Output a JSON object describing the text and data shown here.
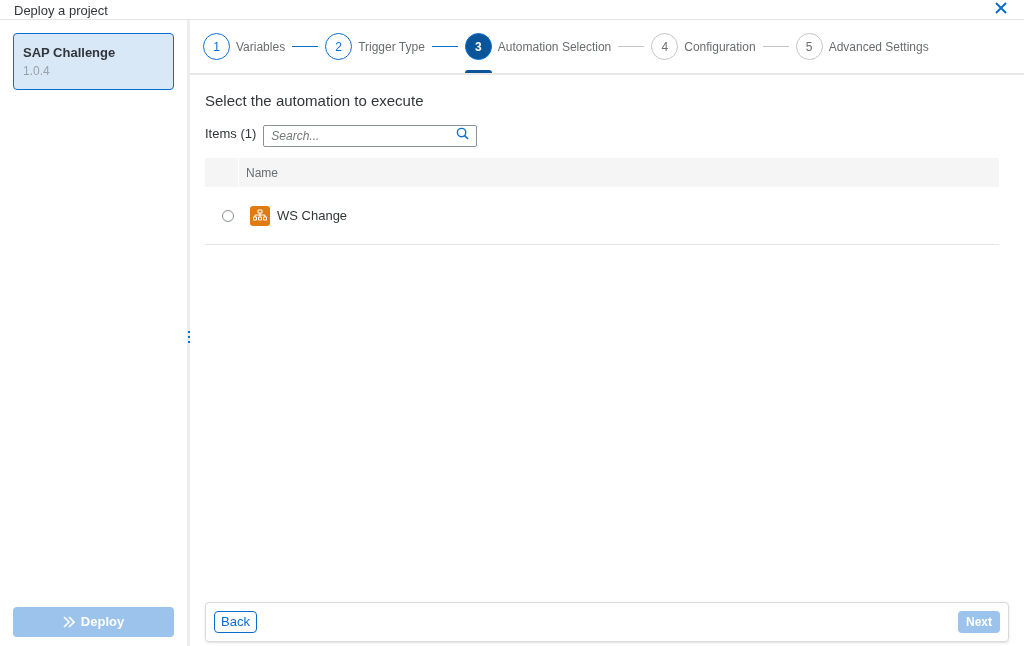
{
  "window": {
    "title": "Deploy a project"
  },
  "sidebar": {
    "project": {
      "name": "SAP Challenge",
      "version": "1.0.4",
      "selected": true
    },
    "deploy_button": {
      "label": "Deploy",
      "disabled": true
    }
  },
  "steps": [
    {
      "number": "1",
      "label": "Variables",
      "completed": true,
      "selected": false
    },
    {
      "number": "2",
      "label": "Trigger Type",
      "completed": true,
      "selected": false
    },
    {
      "number": "3",
      "label": "Automation Selection",
      "completed": false,
      "selected": true
    },
    {
      "number": "4",
      "label": "Configuration",
      "completed": false,
      "selected": false
    },
    {
      "number": "5",
      "label": "Advanced Settings",
      "completed": false,
      "selected": false
    }
  ],
  "content": {
    "heading": "Select the automation to execute",
    "items_count": "Items (1)",
    "search": {
      "placeholder": "Search..."
    },
    "table": {
      "columns": [
        "Name"
      ],
      "rows": [
        {
          "name": "WS Change",
          "selected": false
        }
      ]
    }
  },
  "footer": {
    "back": "Back",
    "next": {
      "label": "Next",
      "disabled": true
    }
  }
}
